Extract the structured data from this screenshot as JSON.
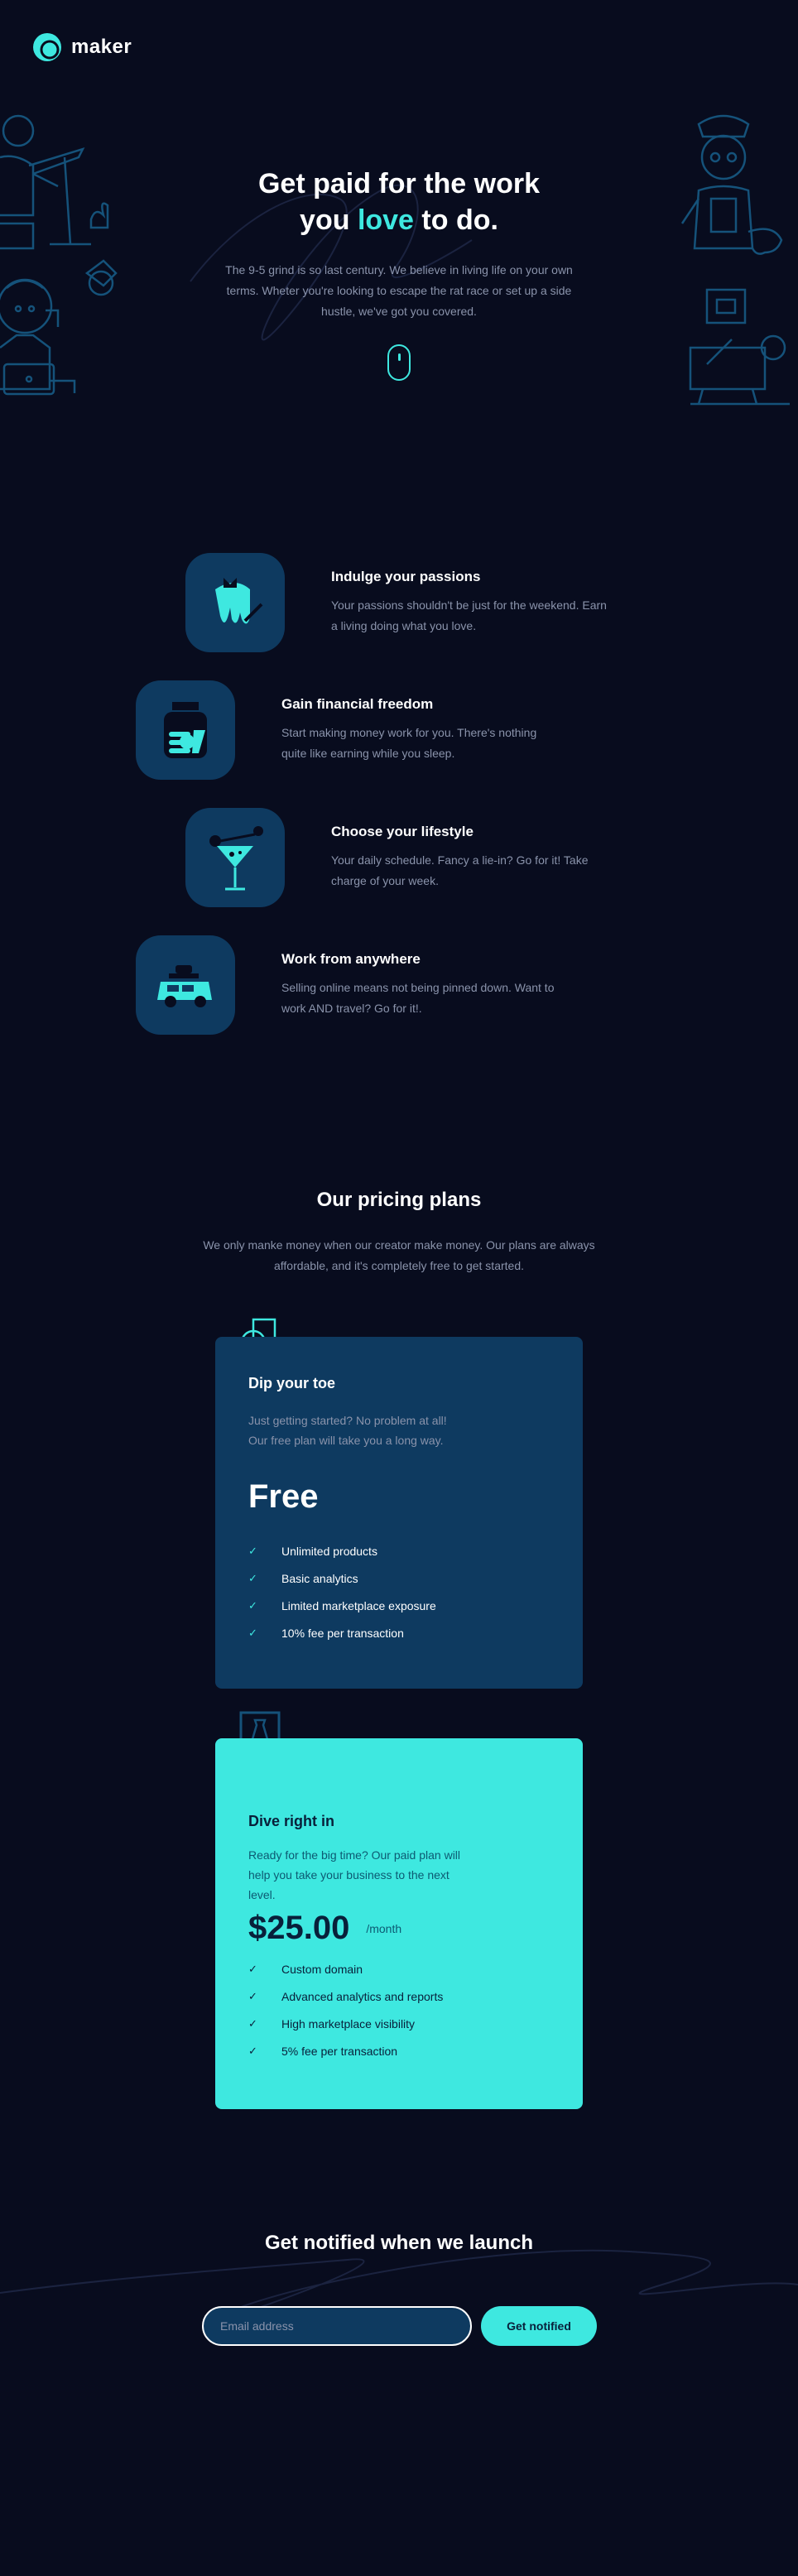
{
  "brand": {
    "name": "maker",
    "accent": "#3ee8e0",
    "background": "#080c1e",
    "panel": "#0e3a60"
  },
  "hero": {
    "title_line1": "Get paid for the work",
    "title_line2_pre": "you ",
    "title_line2_accent": "love",
    "title_line2_post": " to do.",
    "text": "The 9-5 grind is so last century. We believe in living life on your own terms. Wheter you're looking to escape the rat race or set up a side hustle, we've got you covered.",
    "scroll_icon": "mouse-icon"
  },
  "features": [
    {
      "icon": "paint-drip-icon",
      "title": "Indulge your passions",
      "text": "Your passions shouldn't be just for the weekend. Earn a living doing what you love."
    },
    {
      "icon": "money-jar-icon",
      "title": "Gain financial freedom",
      "text": "Start making money work for you. There's nothing quite like earning while you sleep."
    },
    {
      "icon": "cocktail-icon",
      "title": "Choose your lifestyle",
      "text": "Your daily schedule. Fancy a lie-in? Go for it! Take charge of your week."
    },
    {
      "icon": "car-icon",
      "title": "Work from anywhere",
      "text": "Selling online means not being pinned down. Want to work AND travel? Go for it!."
    }
  ],
  "pricing": {
    "title": "Our pricing plans",
    "subtitle": "We only manke money when our creator make money. Our plans are always affordable, and it's completely free to get started.",
    "plans": [
      {
        "name": "Dip your toe",
        "description": "Just getting started? No problem at all! Our free plan will take you a long way.",
        "price": "Free",
        "period": "",
        "features": [
          "Unlimited products",
          "Basic analytics",
          "Limited marketplace exposure",
          "10% fee per transaction"
        ]
      },
      {
        "name": "Dive right in",
        "description": "Ready for the big time? Our paid plan will help you take your business to the next level.",
        "price": "$25.00",
        "period": "/month",
        "features": [
          "Custom domain",
          "Advanced analytics and reports",
          "High marketplace visibility",
          "5% fee per transaction"
        ]
      }
    ]
  },
  "notify": {
    "title": "Get notified when we launch",
    "placeholder": "Email address",
    "button": "Get notified"
  }
}
